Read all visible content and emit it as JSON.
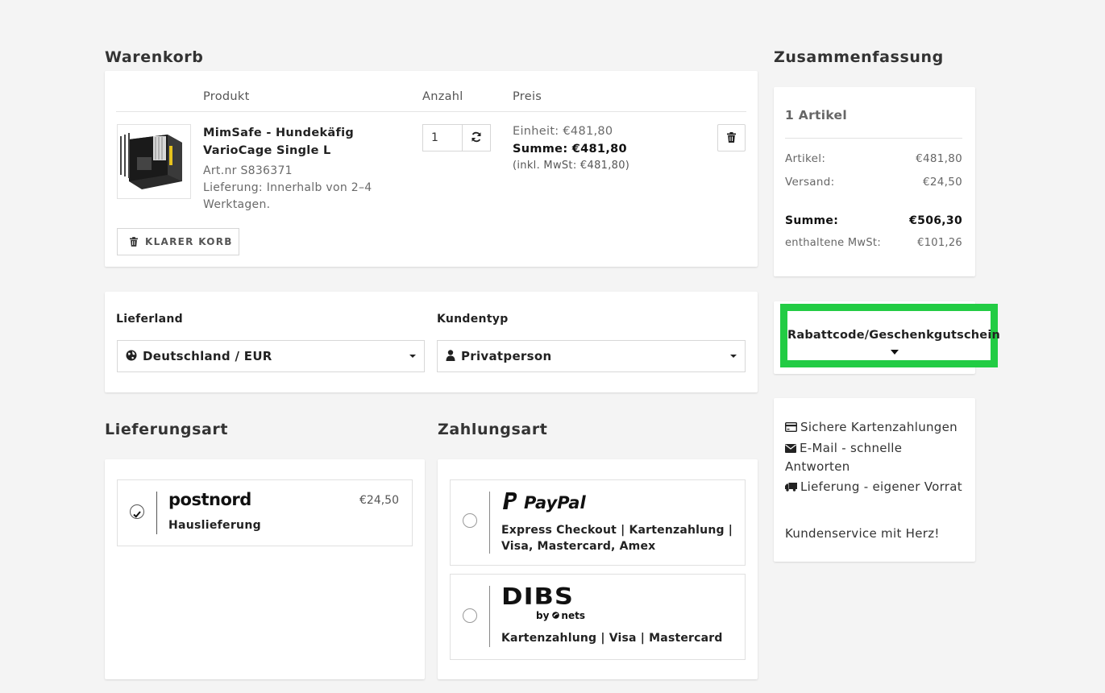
{
  "cart": {
    "heading": "Warenkorb",
    "columns": {
      "product": "Produkt",
      "quantity": "Anzahl",
      "price": "Preis"
    },
    "item": {
      "name_line1": "MimSafe - Hundekäfig",
      "name_line2": "VarioCage Single L",
      "article_number": "Art.nr S836371",
      "delivery_line1": "Lieferung: Innerhalb von 2–4",
      "delivery_line2": "Werktagen.",
      "quantity": "1",
      "unit_price": "Einheit: €481,80",
      "sum": "Summe: €481,80",
      "vat": "(inkl. MwSt: €481,80)"
    },
    "clear_label": "KLARER KORB"
  },
  "shipping_setup": {
    "country_label": "Lieferland",
    "country_value": "Deutschland / EUR",
    "customer_label": "Kundentyp",
    "customer_value": "Privatperson"
  },
  "delivery": {
    "heading": "Lieferungsart",
    "options": [
      {
        "logo_text": "postnord",
        "label": "Hauslieferung",
        "price": "€24,50",
        "selected": true
      }
    ]
  },
  "payment": {
    "heading": "Zahlungsart",
    "options": [
      {
        "logo_text": "PayPal",
        "line1": "Express Checkout | Kartenzahlung |",
        "line2": "Visa, Mastercard, Amex"
      },
      {
        "logo_text": "DIBS",
        "logo_sub": "by",
        "logo_sub2": "nets",
        "line1": "Kartenzahlung | Visa | Mastercard"
      }
    ]
  },
  "summary": {
    "heading": "Zusammenfassung",
    "count": "1 Artikel",
    "rows": [
      {
        "label": "Artikel:",
        "value": "€481,80"
      },
      {
        "label": "Versand:",
        "value": "€24,50"
      }
    ],
    "total_label": "Summe:",
    "total_value": "€506,30",
    "vat_label": "enthaltene MwSt:",
    "vat_value": "€101,26"
  },
  "coupon": {
    "label": "Rabattcode/Geschenkgutschein"
  },
  "trust": {
    "items": [
      "Sichere Kartenzahlungen",
      "E-Mail - schnelle Antworten",
      "Lieferung - eigener Vorrat"
    ],
    "tagline": "Kundenservice mit Herz!"
  },
  "colors": {
    "highlight": "#22cc44",
    "background": "#f4f4f4"
  },
  "icons": [
    "refresh-icon",
    "trash-icon",
    "globe-icon",
    "user-icon",
    "check-icon",
    "credit-card-icon",
    "envelope-icon",
    "truck-icon",
    "caret-down-icon"
  ]
}
